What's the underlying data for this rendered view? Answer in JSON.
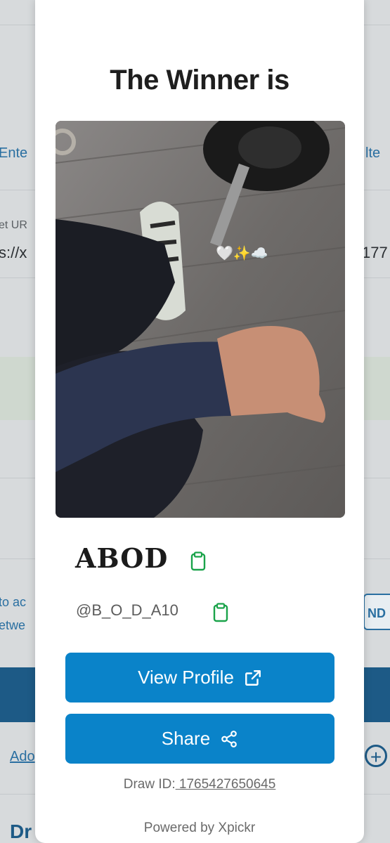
{
  "background": {
    "left_link_1": "Ente",
    "right_link_1": "lte",
    "label_url": "et UR",
    "url_fragment_left": "s://x",
    "url_fragment_right": "177",
    "text_left_1": "to ac",
    "text_left_2": "etwe",
    "button_right": "ND",
    "add_link": "Ado",
    "bottom_heading": "Dr"
  },
  "modal": {
    "title": "The Winner is",
    "winner_name": "ABOD",
    "winner_handle": "@B_O_D_A10",
    "view_profile_label": "View Profile",
    "share_label": "Share",
    "draw_id_label": "Draw ID:",
    "draw_id_value": " 1765427650645",
    "powered_by": "Powered by Xpickr",
    "emoji_overlay": "🤍✨☁️"
  },
  "colors": {
    "primary_button": "#0a83c9",
    "copy_icon": "#1aa34a",
    "title_text": "#1e1e1e"
  },
  "icons": [
    "clipboard-icon",
    "external-link-icon",
    "share-icon",
    "plus-circle-icon"
  ]
}
